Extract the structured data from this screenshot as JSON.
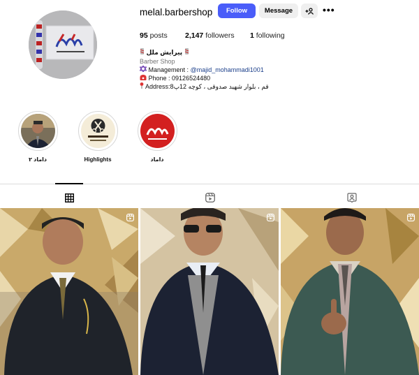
{
  "header": {
    "username": "melal.barbershop",
    "follow_label": "Follow",
    "message_label": "Message",
    "add_user_label": "+A",
    "more_label": "•••"
  },
  "stats": {
    "posts_count": "95",
    "posts_label": "posts",
    "followers_count": "2,147",
    "followers_label": "followers",
    "following_count": "1",
    "following_label": "following"
  },
  "bio": {
    "name": "پیرایش ملل",
    "category": "Barber Shop",
    "management_label": "Management : ",
    "management_handle": "@majid_mohammadi1001",
    "phone": "Phone : 09126524480",
    "address": "Address:قم ، بلوار شهید صدوقی ، کوچه 12پ8"
  },
  "highlights": [
    {
      "label": "داماد ۲"
    },
    {
      "label": "Highlights"
    },
    {
      "label": "داماد"
    }
  ],
  "tabs": [
    {
      "name": "posts",
      "icon": "grid-icon"
    },
    {
      "name": "reels",
      "icon": "reels-icon"
    },
    {
      "name": "tagged",
      "icon": "tagged-icon"
    }
  ],
  "colors": {
    "follow_button": "#4a5df9",
    "secondary_button": "#efefef",
    "link": "#1b3f8a",
    "muted_text": "#737373",
    "divider": "#dbdbdb"
  }
}
